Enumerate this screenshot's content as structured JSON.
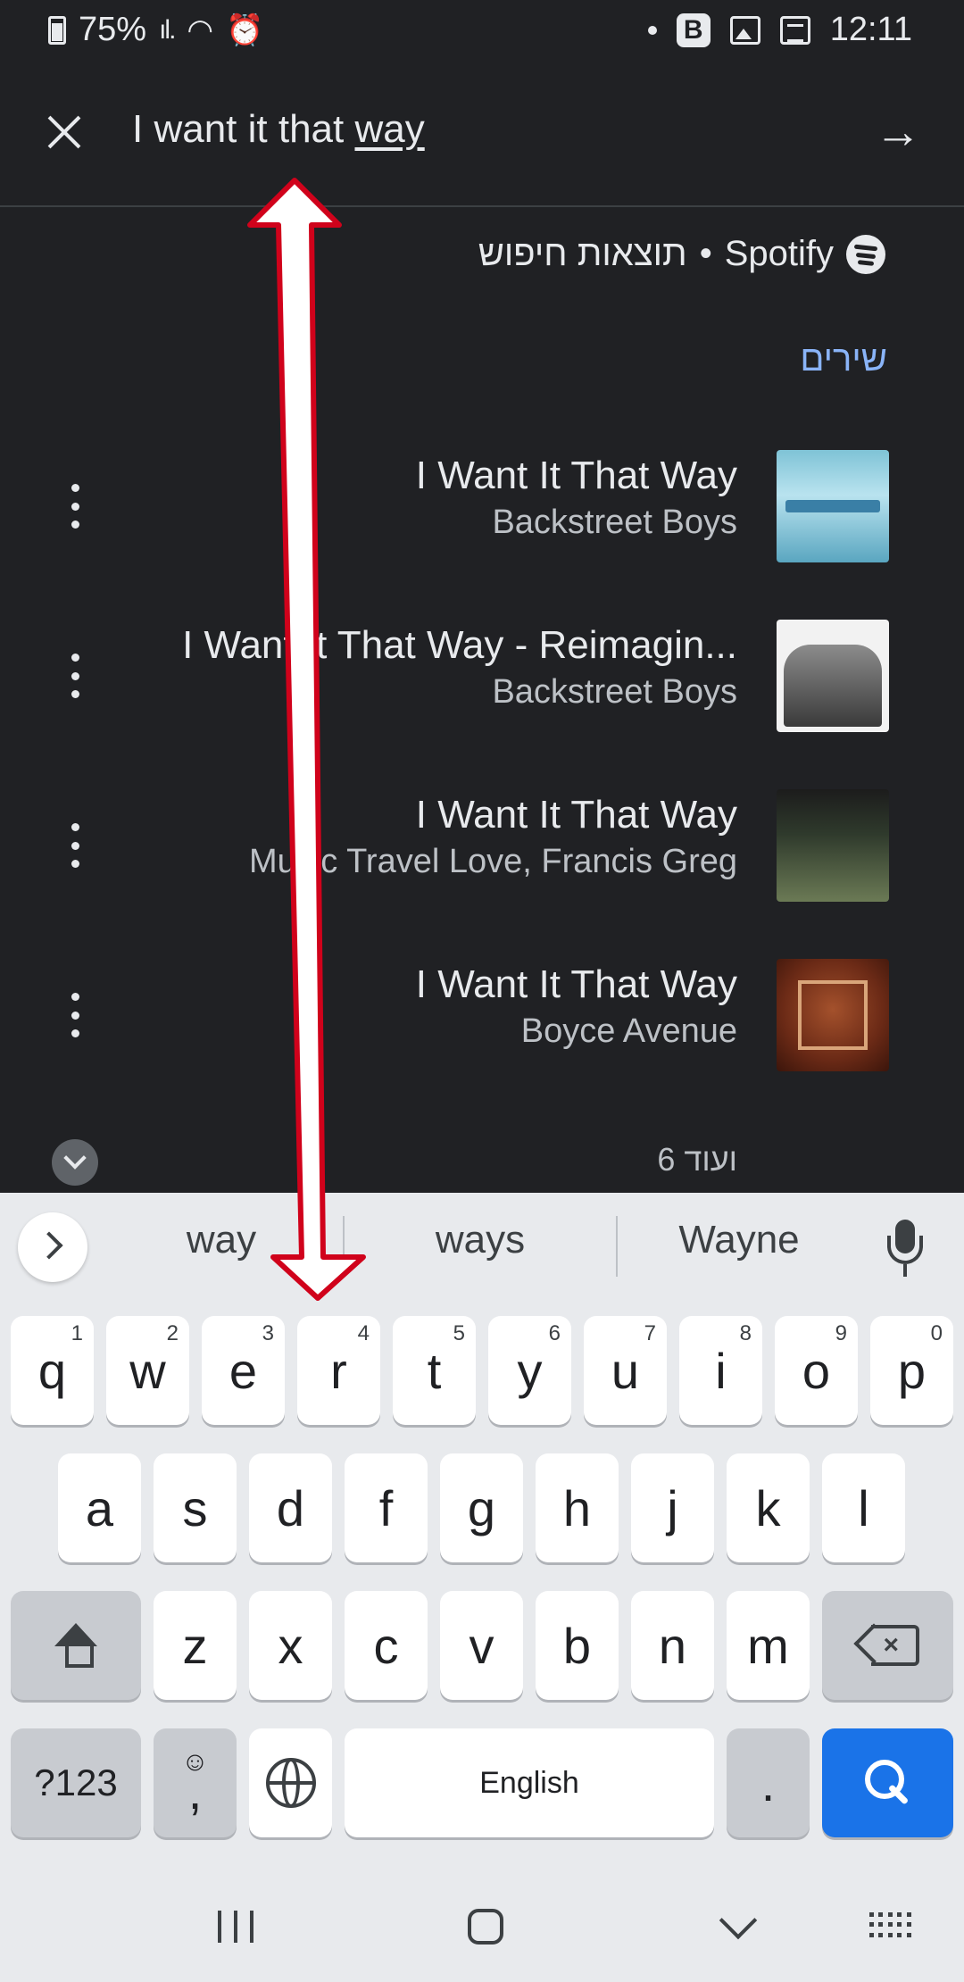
{
  "status_bar": {
    "battery": "75%",
    "time": "12:11",
    "icons": [
      "battery-icon",
      "signal-icon",
      "wifi-icon",
      "alarm-icon",
      "dot-icon",
      "b-app-icon",
      "gallery-icon",
      "news-icon"
    ],
    "b_label": "B"
  },
  "search": {
    "query_prefix": "I want it that ",
    "query_underlined": "way"
  },
  "results": {
    "source": "Spotify",
    "source_label": "תוצאות חיפוש",
    "separator": "•",
    "section_title": "שירים",
    "items": [
      {
        "title": "I Want It That Way",
        "artist": "Backstreet Boys"
      },
      {
        "title": "I Want It That Way - Reimagin...",
        "artist": "Backstreet Boys"
      },
      {
        "title": "I Want It That Way",
        "artist": "Music Travel Love, Francis Greg"
      },
      {
        "title": "I Want It That Way",
        "artist": "Boyce Avenue"
      }
    ],
    "more_label": "ועוד 6"
  },
  "keyboard": {
    "suggestions": [
      "way",
      "ways",
      "Wayne"
    ],
    "row1": [
      {
        "k": "q",
        "h": "1"
      },
      {
        "k": "w",
        "h": "2"
      },
      {
        "k": "e",
        "h": "3"
      },
      {
        "k": "r",
        "h": "4"
      },
      {
        "k": "t",
        "h": "5"
      },
      {
        "k": "y",
        "h": "6"
      },
      {
        "k": "u",
        "h": "7"
      },
      {
        "k": "i",
        "h": "8"
      },
      {
        "k": "o",
        "h": "9"
      },
      {
        "k": "p",
        "h": "0"
      }
    ],
    "row2": [
      "a",
      "s",
      "d",
      "f",
      "g",
      "h",
      "j",
      "k",
      "l"
    ],
    "row3": [
      "z",
      "x",
      "c",
      "v",
      "b",
      "n",
      "m"
    ],
    "symbols_label": "?123",
    "emoji_glyph": "☺",
    "comma": ",",
    "space_label": "English",
    "period": "."
  },
  "colors": {
    "accent": "#1a73e8",
    "section_title": "#8ab4f8",
    "annotation_arrow": "#d0021b"
  }
}
